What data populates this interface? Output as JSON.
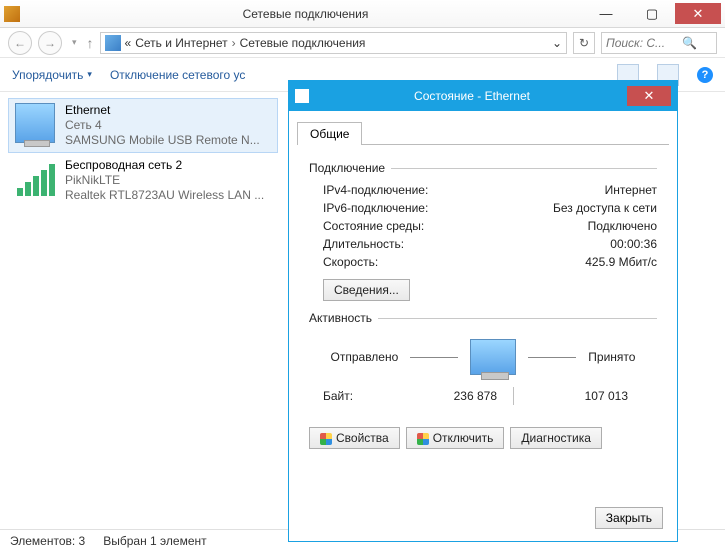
{
  "colors": {
    "accent": "#1aa1e2",
    "danger": "#c75050",
    "link": "#255b9c"
  },
  "window": {
    "title": "Сетевые подключения",
    "glyphs": {
      "min": "—",
      "max": "▢",
      "close": "✕"
    }
  },
  "addr": {
    "back_glyph": "←",
    "fwd_glyph": "→",
    "recent_glyph": "▾",
    "crumb_lead": "«",
    "crumb1": "Сеть и Интернет",
    "crumb2": "Сетевые подключения",
    "crumb_sep": "›",
    "dropdown_glyph": "⌄",
    "refresh_glyph": "↻",
    "search_placeholder": "Поиск: С...",
    "search_glyph": "🔍"
  },
  "tb": {
    "organize": "Упорядочить",
    "disable": "Отключение сетевого ус",
    "help_glyph": "?"
  },
  "items": [
    {
      "name": "Ethernet",
      "line2": "Сеть  4",
      "line3": "SAMSUNG Mobile USB Remote N...",
      "selected": true
    },
    {
      "name": "Беспроводная сеть 2",
      "line2": "PikNikLTE",
      "line3": "Realtek RTL8723AU Wireless LAN ...",
      "selected": false
    }
  ],
  "status": {
    "count": "Элементов: 3",
    "sel": "Выбран 1 элемент"
  },
  "dlg": {
    "title": "Состояние - Ethernet",
    "close_glyph": "✕",
    "tab": "Общие",
    "group_conn": "Подключение",
    "rows": {
      "ipv4_k": "IPv4-подключение:",
      "ipv4_v": "Интернет",
      "ipv6_k": "IPv6-подключение:",
      "ipv6_v": "Без доступа к сети",
      "media_k": "Состояние среды:",
      "media_v": "Подключено",
      "dur_k": "Длительность:",
      "dur_v": "00:00:36",
      "speed_k": "Скорость:",
      "speed_v": "425.9 Мбит/с"
    },
    "details_btn": "Сведения...",
    "group_act": "Активность",
    "sent_label": "Отправлено",
    "recv_label": "Принято",
    "bytes_label": "Байт:",
    "bytes_sent": "236 878",
    "bytes_recv": "107 013",
    "props_btn": "Свойства",
    "disable_btn": "Отключить",
    "diag_btn": "Диагностика",
    "close_btn": "Закрыть"
  }
}
